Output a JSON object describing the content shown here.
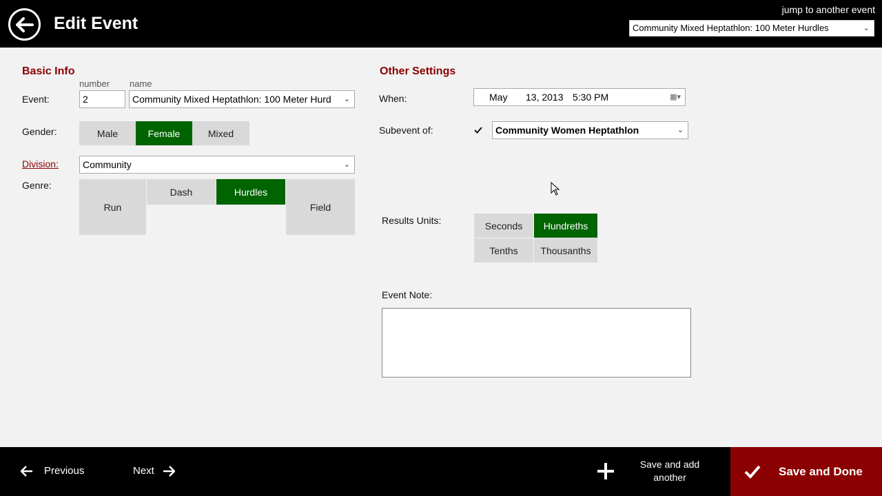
{
  "header": {
    "title": "Edit Event",
    "jump_label": "jump to another event",
    "jump_select_value": "Community Mixed Heptathlon: 100 Meter Hurdles"
  },
  "basic_info": {
    "section_title": "Basic Info",
    "number_label": "number",
    "name_label": "name",
    "event_label": "Event:",
    "event_number": "2",
    "event_name": "Community Mixed Heptathlon: 100 Meter Hurd",
    "gender_label": "Gender:",
    "gender_options": [
      "Male",
      "Female",
      "Mixed"
    ],
    "gender_selected": "Female",
    "division_label": "Division:",
    "division_value": "Community",
    "genre_label": "Genre:",
    "genre_options": [
      "Run",
      "Dash",
      "Hurdles",
      "Field"
    ],
    "genre_selected": "Hurdles"
  },
  "other_settings": {
    "section_title": "Other Settings",
    "when_label": "When:",
    "when_month": "May",
    "when_day_year": "13, 2013",
    "when_time": "5:30 PM",
    "subevent_label": "Subevent of:",
    "subevent_checked": true,
    "subevent_value": "Community Women Heptathlon",
    "results_units_label": "Results Units:",
    "results_units_options": [
      "Seconds",
      "Hundreths",
      "Tenths",
      "Thousanths"
    ],
    "results_units_selected": "Hundreths",
    "event_note_label": "Event Note:",
    "event_note_value": ""
  },
  "footer": {
    "previous_label": "Previous",
    "next_label": "Next",
    "save_add_label": "Save and add another",
    "save_done_label": "Save and Done"
  },
  "colors": {
    "accent_green": "#006400",
    "accent_red": "#8b0000",
    "header_bg": "#000000"
  }
}
